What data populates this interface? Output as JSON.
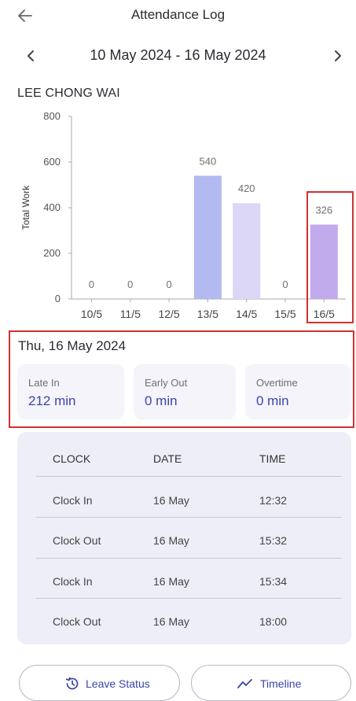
{
  "header": {
    "title": "Attendance Log",
    "back_icon": "arrow-left-icon"
  },
  "range": {
    "label": "10 May 2024 - 16 May 2024",
    "prev_icon": "chevron-left-icon",
    "next_icon": "chevron-right-icon"
  },
  "employee": {
    "name": "LEE CHONG WAI"
  },
  "chart_data": {
    "type": "bar",
    "categories": [
      "10/5",
      "11/5",
      "12/5",
      "13/5",
      "14/5",
      "15/5",
      "16/5"
    ],
    "values": [
      0,
      0,
      0,
      540,
      420,
      0,
      326
    ],
    "ylabel": "Total Work",
    "ylim": [
      0,
      800
    ],
    "yticks": [
      0,
      200,
      400,
      600,
      800
    ],
    "bar_colors": [
      "#b3b9f1",
      "#b3b9f1",
      "#b3b9f1",
      "#b3b9f1",
      "#dcd7f7",
      "#b3b9f1",
      "#c1abed"
    ],
    "data_labels": true,
    "grid": false
  },
  "day": {
    "title": "Thu, 16 May 2024",
    "stats": [
      {
        "label": "Late In",
        "value": "212 min"
      },
      {
        "label": "Early Out",
        "value": "0 min"
      },
      {
        "label": "Overtime",
        "value": "0 min"
      }
    ]
  },
  "clock_table": {
    "headers": [
      "CLOCK",
      "DATE",
      "TIME"
    ],
    "rows": [
      [
        "Clock In",
        "16 May",
        "12:32"
      ],
      [
        "Clock Out",
        "16 May",
        "15:32"
      ],
      [
        "Clock In",
        "16 May",
        "15:34"
      ],
      [
        "Clock Out",
        "16 May",
        "18:00"
      ]
    ]
  },
  "actions": {
    "leave": {
      "label": "Leave Status",
      "icon": "history-icon"
    },
    "timeline": {
      "label": "Timeline",
      "icon": "trend-line-icon"
    }
  },
  "colors": {
    "accent": "#3a45a8",
    "highlight": "#d32f2f",
    "card_bg": "#f4f4fa",
    "panel_bg": "#eeeef9"
  }
}
